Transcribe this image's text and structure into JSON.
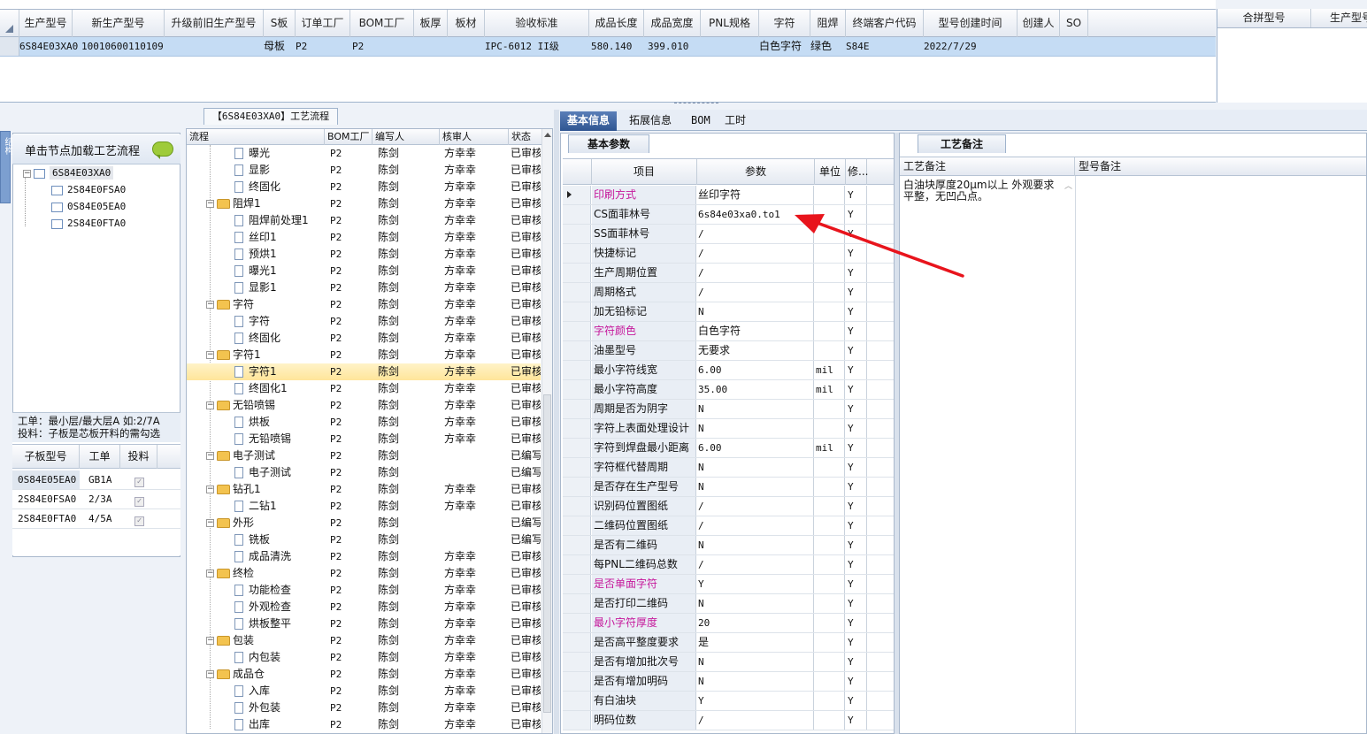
{
  "top_grid": {
    "headers": [
      "生产型号",
      "新生产型号",
      "升级前旧生产型号",
      "S板",
      "订单工厂",
      "BOM工厂",
      "板厚",
      "板材",
      "验收标准",
      "成品长度",
      "成品宽度",
      "PNL规格",
      "字符",
      "阻焊",
      "终端客户代码",
      "型号创建时间",
      "创建人",
      "SO"
    ],
    "row": {
      "model": "6S84E03XA0",
      "new_model": "10010600110109",
      "s_board": "母板",
      "order_factory": "P2",
      "bom_factory": "P2",
      "standard": "IPC-6012 II级",
      "length": "580.140",
      "width": "399.010",
      "char": "白色字符",
      "mask": "绿色",
      "customer": "S84E",
      "created": "2022/7/29"
    }
  },
  "merge_grid": {
    "headers": [
      "合拼型号",
      "生产型号"
    ]
  },
  "left": {
    "side_tab": "结构",
    "hint": "单击节点加载工艺流程",
    "tree": [
      "6S84E03XA0",
      "2S84E0FSA0",
      "0S84E05EA0",
      "2S84E0FTA0"
    ],
    "note1": "工单：最小层/最大层A 如:2/7A",
    "note2": "投料：子板是芯板开料的需勾选",
    "sub_headers": [
      "子板型号",
      "工单",
      "投料"
    ],
    "sub_rows": [
      {
        "model": "0S84E05EA0",
        "order": "GB1A"
      },
      {
        "model": "2S84E0FSA0",
        "order": "2/3A"
      },
      {
        "model": "2S84E0FTA0",
        "order": "4/5A"
      }
    ]
  },
  "flow": {
    "title": "【6S84E03XA0】工艺流程",
    "headers": [
      "流程",
      "BOM工厂",
      "编写人",
      "核审人",
      "状态"
    ],
    "rows": [
      {
        "name": "曝光",
        "type": "doc",
        "bom": "P2",
        "writer": "陈剑",
        "reviewer": "方幸幸",
        "status": "已审核"
      },
      {
        "name": "显影",
        "type": "doc",
        "bom": "P2",
        "writer": "陈剑",
        "reviewer": "方幸幸",
        "status": "已审核"
      },
      {
        "name": "终固化",
        "type": "doc",
        "bom": "P2",
        "writer": "陈剑",
        "reviewer": "方幸幸",
        "status": "已审核"
      },
      {
        "name": "阻焊1",
        "type": "folder",
        "bom": "P2",
        "writer": "陈剑",
        "reviewer": "方幸幸",
        "status": "已审核"
      },
      {
        "name": "阻焊前处理1",
        "type": "doc",
        "bom": "P2",
        "writer": "陈剑",
        "reviewer": "方幸幸",
        "status": "已审核"
      },
      {
        "name": "丝印1",
        "type": "doc",
        "bom": "P2",
        "writer": "陈剑",
        "reviewer": "方幸幸",
        "status": "已审核"
      },
      {
        "name": "预烘1",
        "type": "doc",
        "bom": "P2",
        "writer": "陈剑",
        "reviewer": "方幸幸",
        "status": "已审核"
      },
      {
        "name": "曝光1",
        "type": "doc",
        "bom": "P2",
        "writer": "陈剑",
        "reviewer": "方幸幸",
        "status": "已审核"
      },
      {
        "name": "显影1",
        "type": "doc",
        "bom": "P2",
        "writer": "陈剑",
        "reviewer": "方幸幸",
        "status": "已审核"
      },
      {
        "name": "字符",
        "type": "folder",
        "bom": "P2",
        "writer": "陈剑",
        "reviewer": "方幸幸",
        "status": "已审核"
      },
      {
        "name": "字符",
        "type": "doc",
        "bom": "P2",
        "writer": "陈剑",
        "reviewer": "方幸幸",
        "status": "已审核"
      },
      {
        "name": "终固化",
        "type": "doc",
        "bom": "P2",
        "writer": "陈剑",
        "reviewer": "方幸幸",
        "status": "已审核"
      },
      {
        "name": "字符1",
        "type": "folder",
        "bom": "P2",
        "writer": "陈剑",
        "reviewer": "方幸幸",
        "status": "已审核"
      },
      {
        "name": "字符1",
        "type": "doc",
        "bom": "P2",
        "writer": "陈剑",
        "reviewer": "方幸幸",
        "status": "已审核",
        "selected": true
      },
      {
        "name": "终固化1",
        "type": "doc",
        "bom": "P2",
        "writer": "陈剑",
        "reviewer": "方幸幸",
        "status": "已审核"
      },
      {
        "name": "无铅喷锡",
        "type": "folder",
        "bom": "P2",
        "writer": "陈剑",
        "reviewer": "方幸幸",
        "status": "已审核"
      },
      {
        "name": "烘板",
        "type": "doc",
        "bom": "P2",
        "writer": "陈剑",
        "reviewer": "方幸幸",
        "status": "已审核"
      },
      {
        "name": "无铅喷锡",
        "type": "doc",
        "bom": "P2",
        "writer": "陈剑",
        "reviewer": "方幸幸",
        "status": "已审核"
      },
      {
        "name": "电子测试",
        "type": "folder",
        "bom": "P2",
        "writer": "陈剑",
        "reviewer": "",
        "status": "已编写"
      },
      {
        "name": "电子测试",
        "type": "doc",
        "bom": "P2",
        "writer": "陈剑",
        "reviewer": "",
        "status": "已编写"
      },
      {
        "name": "钻孔1",
        "type": "folder",
        "bom": "P2",
        "writer": "陈剑",
        "reviewer": "方幸幸",
        "status": "已审核"
      },
      {
        "name": "二钻1",
        "type": "doc",
        "bom": "P2",
        "writer": "陈剑",
        "reviewer": "方幸幸",
        "status": "已审核"
      },
      {
        "name": "外形",
        "type": "folder",
        "bom": "P2",
        "writer": "陈剑",
        "reviewer": "",
        "status": "已编写"
      },
      {
        "name": "铣板",
        "type": "doc",
        "bom": "P2",
        "writer": "陈剑",
        "reviewer": "",
        "status": "已编写"
      },
      {
        "name": "成品清洗",
        "type": "doc",
        "bom": "P2",
        "writer": "陈剑",
        "reviewer": "方幸幸",
        "status": "已审核"
      },
      {
        "name": "终检",
        "type": "folder",
        "bom": "P2",
        "writer": "陈剑",
        "reviewer": "方幸幸",
        "status": "已审核"
      },
      {
        "name": "功能检查",
        "type": "doc",
        "bom": "P2",
        "writer": "陈剑",
        "reviewer": "方幸幸",
        "status": "已审核"
      },
      {
        "name": "外观检查",
        "type": "doc",
        "bom": "P2",
        "writer": "陈剑",
        "reviewer": "方幸幸",
        "status": "已审核"
      },
      {
        "name": "烘板整平",
        "type": "doc",
        "bom": "P2",
        "writer": "陈剑",
        "reviewer": "方幸幸",
        "status": "已审核"
      },
      {
        "name": "包装",
        "type": "folder",
        "bom": "P2",
        "writer": "陈剑",
        "reviewer": "方幸幸",
        "status": "已审核"
      },
      {
        "name": "内包装",
        "type": "doc",
        "bom": "P2",
        "writer": "陈剑",
        "reviewer": "方幸幸",
        "status": "已审核"
      },
      {
        "name": "成品仓",
        "type": "folder",
        "bom": "P2",
        "writer": "陈剑",
        "reviewer": "方幸幸",
        "status": "已审核"
      },
      {
        "name": "入库",
        "type": "doc",
        "bom": "P2",
        "writer": "陈剑",
        "reviewer": "方幸幸",
        "status": "已审核"
      },
      {
        "name": "外包装",
        "type": "doc",
        "bom": "P2",
        "writer": "陈剑",
        "reviewer": "方幸幸",
        "status": "已审核"
      },
      {
        "name": "出库",
        "type": "doc",
        "bom": "P2",
        "writer": "陈剑",
        "reviewer": "方幸幸",
        "status": "已审核"
      }
    ]
  },
  "tabs": [
    "基本信息",
    "拓展信息",
    "BOM",
    "工时"
  ],
  "params": {
    "tab": "基本参数",
    "headers": [
      "项目",
      "参数",
      "单位",
      "修..."
    ],
    "rows": [
      {
        "item": "印刷方式",
        "value": "丝印字符",
        "unit": "",
        "mod": "Y",
        "hl": true,
        "current": true
      },
      {
        "item": "CS面菲林号",
        "value": "6s84e03xa0.to1",
        "unit": "",
        "mod": "Y",
        "mono": true
      },
      {
        "item": "SS面菲林号",
        "value": "/",
        "unit": "",
        "mod": "Y"
      },
      {
        "item": "快捷标记",
        "value": "/",
        "unit": "",
        "mod": "Y"
      },
      {
        "item": "生产周期位置",
        "value": "/",
        "unit": "",
        "mod": "Y"
      },
      {
        "item": "周期格式",
        "value": "/",
        "unit": "",
        "mod": "Y"
      },
      {
        "item": "加无铅标记",
        "value": "N",
        "unit": "",
        "mod": "Y"
      },
      {
        "item": "字符颜色",
        "value": "白色字符",
        "unit": "",
        "mod": "Y",
        "hl": true
      },
      {
        "item": "油墨型号",
        "value": "无要求",
        "unit": "",
        "mod": "Y"
      },
      {
        "item": "最小字符线宽",
        "value": "6.00",
        "unit": "mil",
        "mod": "Y"
      },
      {
        "item": "最小字符高度",
        "value": "35.00",
        "unit": "mil",
        "mod": "Y"
      },
      {
        "item": "周期是否为阴字",
        "value": "N",
        "unit": "",
        "mod": "Y"
      },
      {
        "item": "字符上表面处理设计",
        "value": "N",
        "unit": "",
        "mod": "Y"
      },
      {
        "item": "字符到焊盘最小距离",
        "value": "6.00",
        "unit": "mil",
        "mod": "Y"
      },
      {
        "item": "字符框代替周期",
        "value": "N",
        "unit": "",
        "mod": "Y"
      },
      {
        "item": "是否存在生产型号",
        "value": "N",
        "unit": "",
        "mod": "Y"
      },
      {
        "item": "识别码位置图纸",
        "value": "/",
        "unit": "",
        "mod": "Y"
      },
      {
        "item": "二维码位置图纸",
        "value": "/",
        "unit": "",
        "mod": "Y"
      },
      {
        "item": "是否有二维码",
        "value": "N",
        "unit": "",
        "mod": "Y"
      },
      {
        "item": "每PNL二维码总数",
        "value": "/",
        "unit": "",
        "mod": "Y"
      },
      {
        "item": "是否单面字符",
        "value": "Y",
        "unit": "",
        "mod": "Y",
        "hl": true
      },
      {
        "item": "是否打印二维码",
        "value": "N",
        "unit": "",
        "mod": "Y"
      },
      {
        "item": "最小字符厚度",
        "value": "20",
        "unit": "",
        "mod": "Y",
        "hl": true
      },
      {
        "item": "是否高平整度要求",
        "value": "是",
        "unit": "",
        "mod": "Y"
      },
      {
        "item": "是否有增加批次号",
        "value": "N",
        "unit": "",
        "mod": "Y"
      },
      {
        "item": "是否有增加明码",
        "value": "N",
        "unit": "",
        "mod": "Y"
      },
      {
        "item": "有白油块",
        "value": "Y",
        "unit": "",
        "mod": "Y"
      },
      {
        "item": "明码位数",
        "value": "/",
        "unit": "",
        "mod": "Y"
      }
    ]
  },
  "notes": {
    "tab": "工艺备注",
    "headers": [
      "工艺备注",
      "型号备注"
    ],
    "process_note_1": "白油块厚度20μm以上 外观要求",
    "process_note_2": "平整，无凹凸点。"
  },
  "colors": {
    "highlight_item": "#c5179b",
    "annotation_arrow": "#e8141c",
    "selected_row": "#c5dcf4",
    "active_tab": "#2f5591"
  }
}
